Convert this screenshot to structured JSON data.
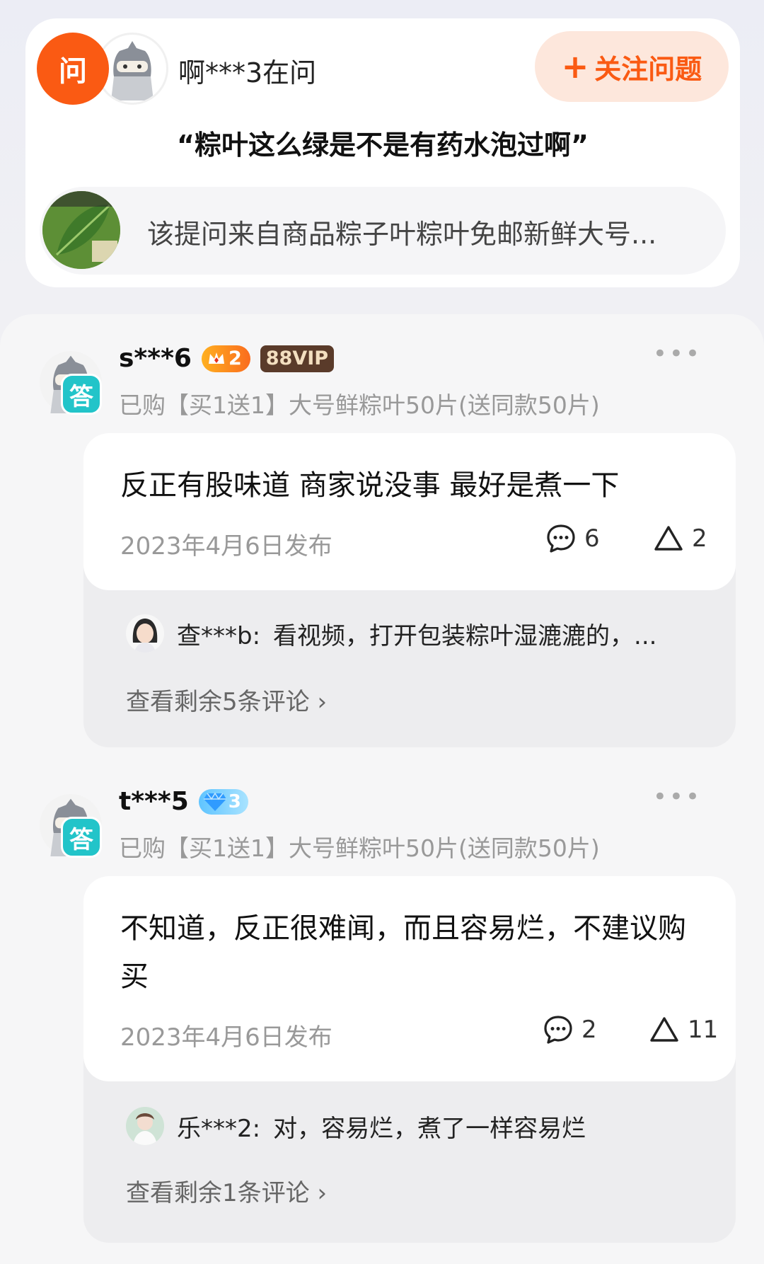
{
  "question": {
    "badge": "问",
    "asker": "啊***3在问",
    "follow_label": "关注问题",
    "title": "“粽叶这么绿是不是有药水泡过啊”",
    "product_text": "该提问来自商品粽子叶粽叶免邮新鲜大号..."
  },
  "answers": [
    {
      "badge": "答",
      "username": "s***6",
      "level": "2",
      "vip": "88VIP",
      "purchase": "已购【买1送1】大号鲜粽叶50片(送同款50片)",
      "text": "反正有股味道 商家说没事  最好是煮一下",
      "date": "2023年4月6日发布",
      "comments": "6",
      "likes": "2",
      "reply_user": "查***b:",
      "reply_text": "看视频，打开包装粽叶湿漉漉的，...",
      "view_more": "查看剩余5条评论 ›"
    },
    {
      "badge": "答",
      "username": "t***5",
      "level": "3",
      "purchase": "已购【买1送1】大号鲜粽叶50片(送同款50片)",
      "text": "不知道，反正很难闻，而且容易烂，不建议购买",
      "date": "2023年4月6日发布",
      "comments": "2",
      "likes": "11",
      "reply_user": "乐***2:",
      "reply_text": "对，容易烂，煮了一样容易烂",
      "view_more": "查看剩余1条评论 ›"
    }
  ],
  "more_icon": "•••",
  "colors": {
    "accent": "#fa5a13",
    "answer_badge": "#22c4c9",
    "vip_bg": "#5a3b2a"
  }
}
